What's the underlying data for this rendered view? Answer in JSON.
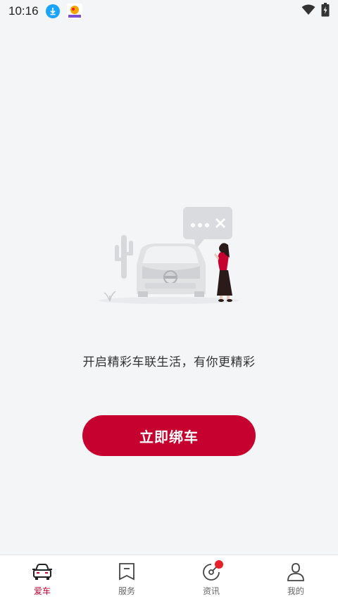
{
  "status_bar": {
    "time": "10:16",
    "icons": [
      "download-icon",
      "app-notification-icon",
      "wifi-icon",
      "battery-charging-icon"
    ]
  },
  "main": {
    "tagline": "开启精彩车联生活，有你更精彩",
    "bind_button_label": "立即绑车"
  },
  "bottom_nav": {
    "items": [
      {
        "label": "爱车",
        "icon": "car-icon",
        "active": true
      },
      {
        "label": "服务",
        "icon": "service-icon",
        "active": false
      },
      {
        "label": "资讯",
        "icon": "news-icon",
        "active": false,
        "badge": true
      },
      {
        "label": "我的",
        "icon": "profile-icon",
        "active": false
      }
    ]
  },
  "colors": {
    "accent": "#c6002f",
    "background": "#f4f5f7",
    "badge": "#e8202a"
  }
}
